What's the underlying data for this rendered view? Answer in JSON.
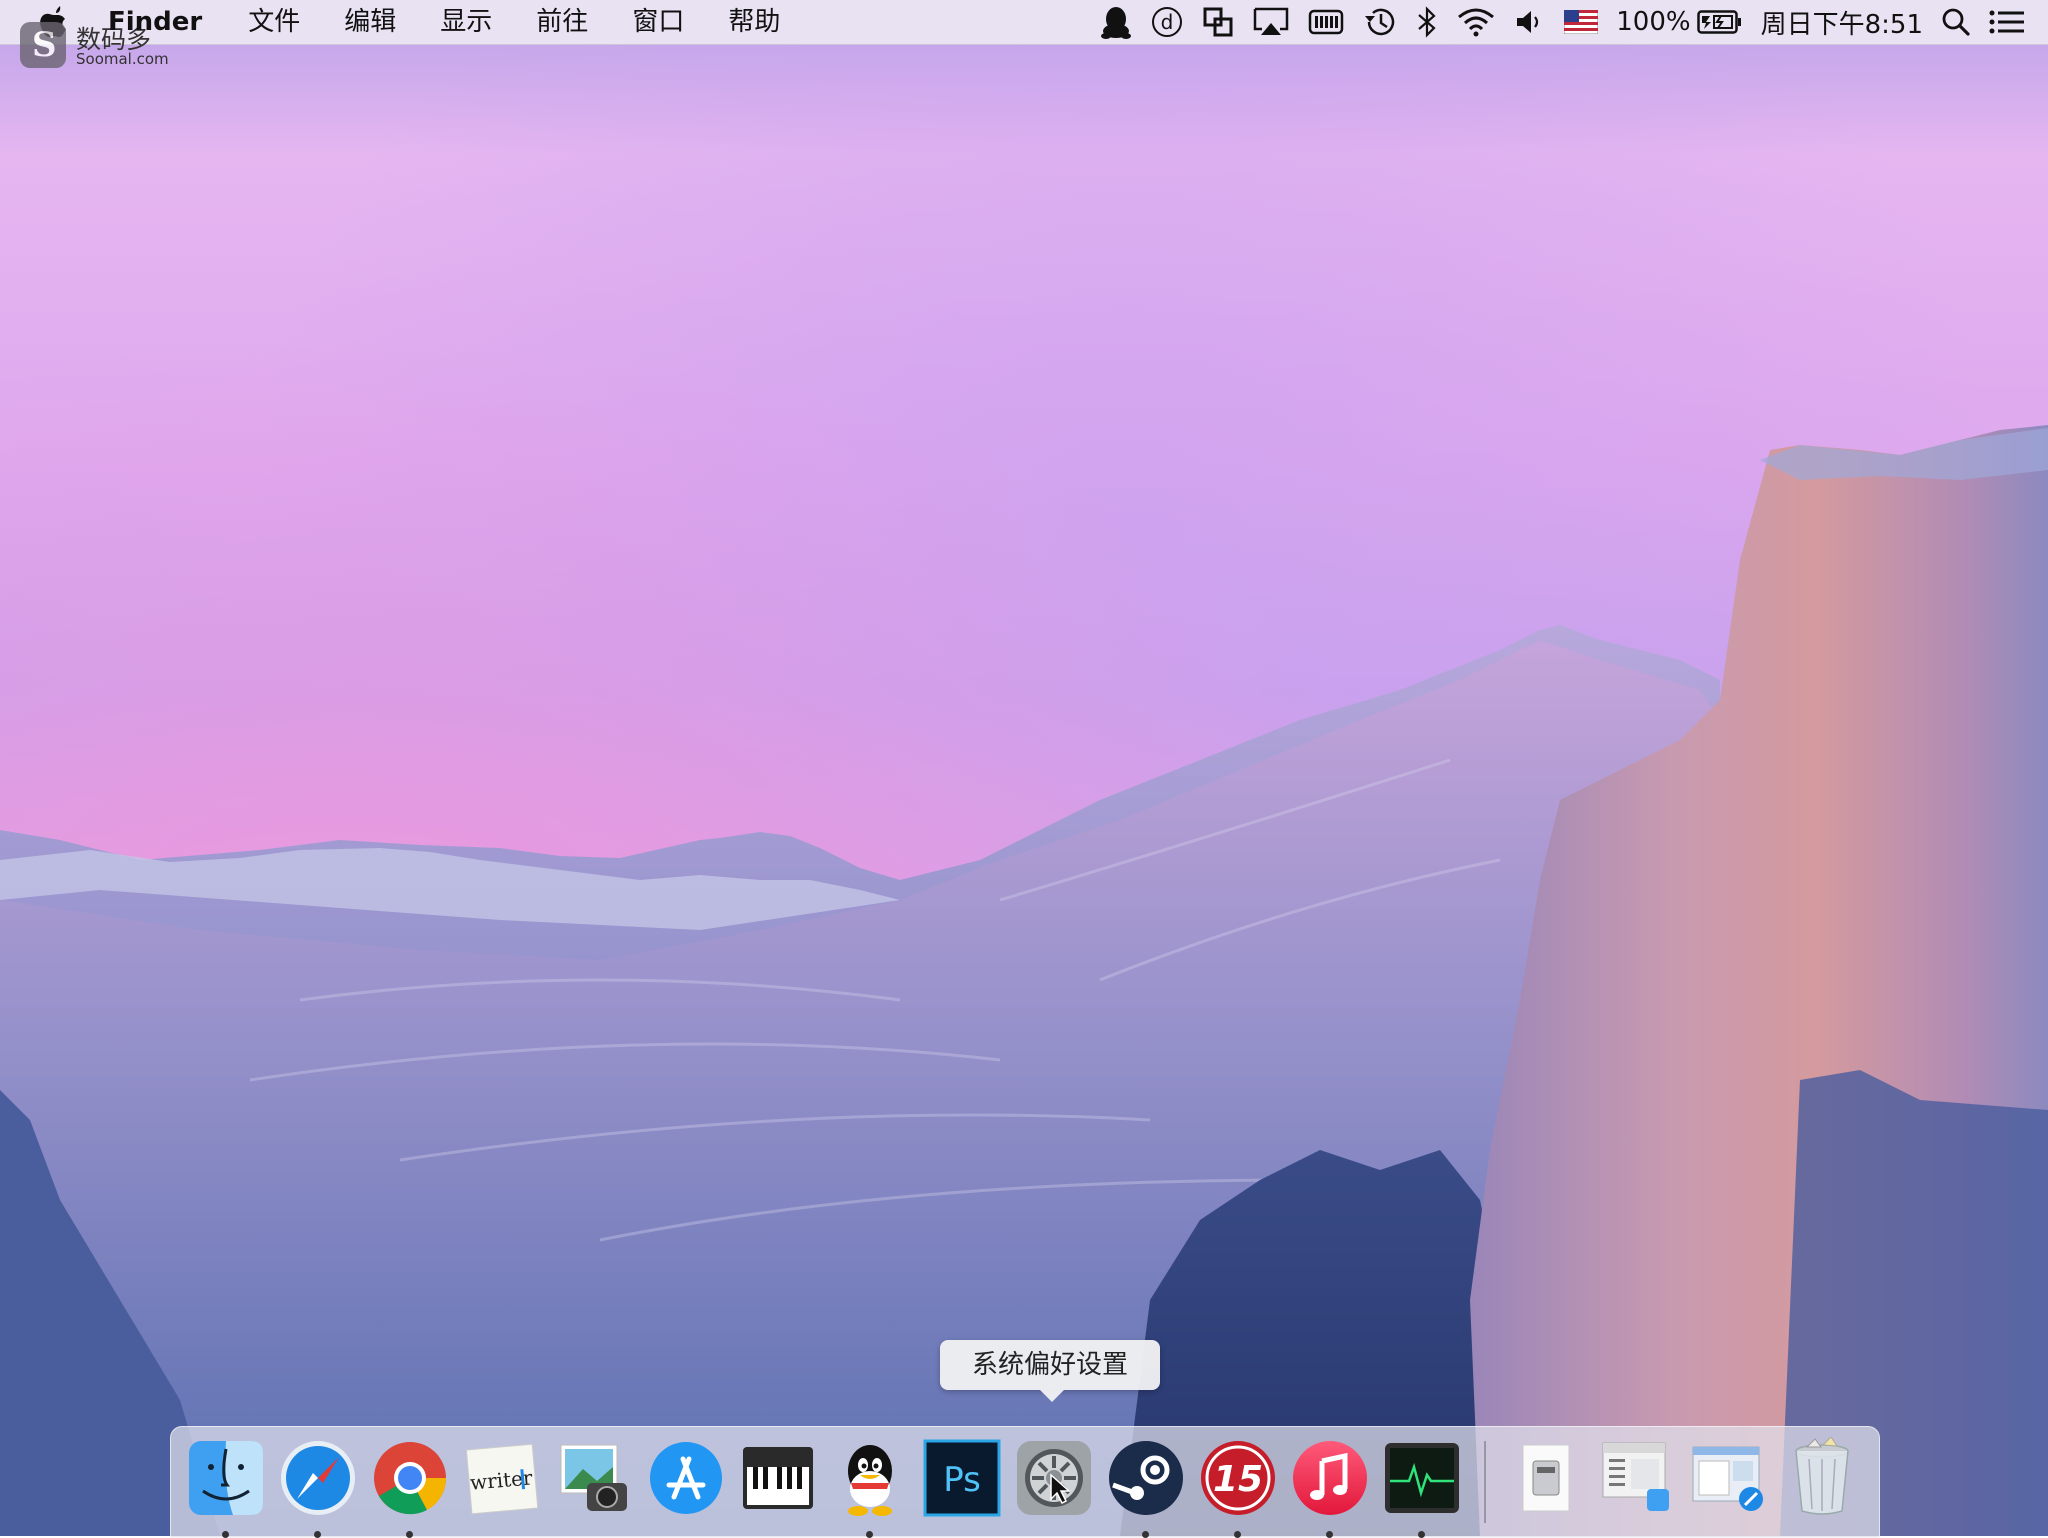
{
  "watermark": {
    "cn": "数码多",
    "en": "Soomal.com"
  },
  "menubar": {
    "app_name": "Finder",
    "menus": [
      "文件",
      "编辑",
      "显示",
      "前往",
      "窗口",
      "帮助"
    ],
    "status": {
      "battery_percent": "100%",
      "clock": "周日下午8:51"
    },
    "icons": [
      "qq-icon",
      "d-icon",
      "screen-share-icon",
      "airplay-icon",
      "memory-icon",
      "time-machine-icon",
      "bluetooth-icon",
      "wifi-icon",
      "volume-icon",
      "us-flag-icon",
      "battery-icon",
      "spotlight-icon",
      "notification-center-icon"
    ]
  },
  "tooltip": {
    "text": "系统偏好设置"
  },
  "dock": {
    "apps": [
      {
        "name": "finder-icon",
        "running": true
      },
      {
        "name": "safari-icon",
        "running": true
      },
      {
        "name": "chrome-icon",
        "running": true
      },
      {
        "name": "writer-icon",
        "label": "writer",
        "running": false
      },
      {
        "name": "image-capture-icon",
        "running": false
      },
      {
        "name": "app-store-icon",
        "running": false
      },
      {
        "name": "piano-icon",
        "running": false
      },
      {
        "name": "qq-app-icon",
        "running": true
      },
      {
        "name": "photoshop-icon",
        "label": "Ps",
        "running": false
      },
      {
        "name": "system-preferences-icon",
        "running": false
      },
      {
        "name": "steam-icon",
        "running": true
      },
      {
        "name": "fifteen-icon",
        "label": "15",
        "running": true
      },
      {
        "name": "itunes-icon",
        "running": true
      },
      {
        "name": "activity-monitor-icon",
        "running": true
      },
      {
        "name": "applications-stack-icon",
        "running": false
      },
      {
        "name": "documents-stack-icon",
        "running": false
      },
      {
        "name": "downloads-stack-icon",
        "running": false
      },
      {
        "name": "trash-icon",
        "running": false
      }
    ]
  }
}
